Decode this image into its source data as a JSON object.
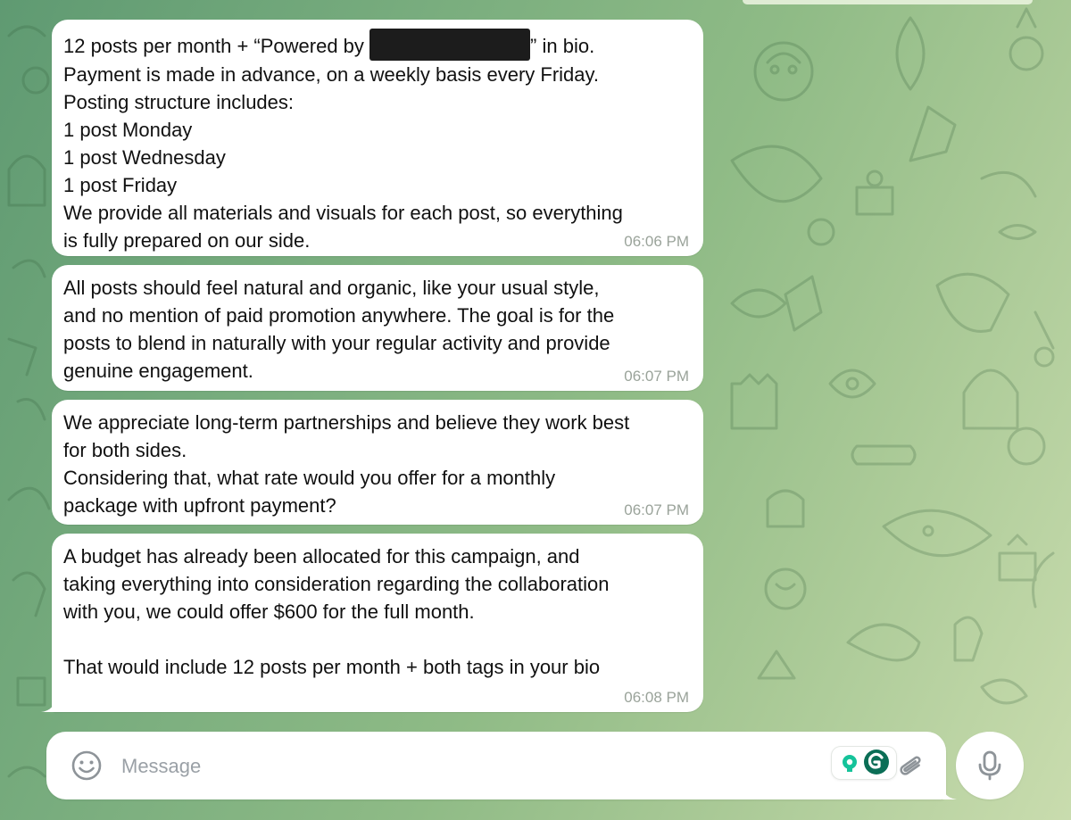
{
  "messages": [
    {
      "lines": [
        {
          "before": "12 posts per month + “Powered by ",
          "redacted": true,
          "after": "” in bio."
        },
        "Payment is made in advance, on a weekly basis every Friday.",
        "Posting structure includes:",
        "1 post Monday",
        "1 post Wednesday",
        "1 post Friday",
        "We provide all materials and visuals for each post, so everything",
        "is fully prepared on our side."
      ],
      "time": "06:06 PM"
    },
    {
      "lines": [
        "All posts should feel natural and organic, like your usual style,",
        "and no mention of paid promotion anywhere. The goal is for the",
        "posts to blend in naturally with your regular activity and provide",
        "genuine engagement."
      ],
      "time": "06:07 PM"
    },
    {
      "lines": [
        "We appreciate long-term partnerships and believe they work best",
        "for both sides.",
        "Considering that, what rate would you offer for a monthly",
        "package with upfront payment?"
      ],
      "time": "06:07 PM"
    },
    {
      "lines": [
        "A budget has already been allocated for this campaign, and",
        "taking everything into consideration regarding the collaboration",
        "with you, we could offer $600 for the full month.",
        "",
        "That would include 12 posts per month + both tags in your bio"
      ],
      "time": "06:08 PM"
    }
  ],
  "composer": {
    "placeholder": "Message",
    "value": ""
  },
  "icons": {
    "emoji": "smiley-icon",
    "grammarly": "grammarly-icon",
    "attach": "paperclip-icon",
    "mic": "microphone-icon"
  },
  "colors": {
    "bubble": "#ffffff",
    "timestamp": "#9aa39a",
    "grammarly_green": "#15c39a",
    "grammarly_dark": "#0b6e56"
  }
}
